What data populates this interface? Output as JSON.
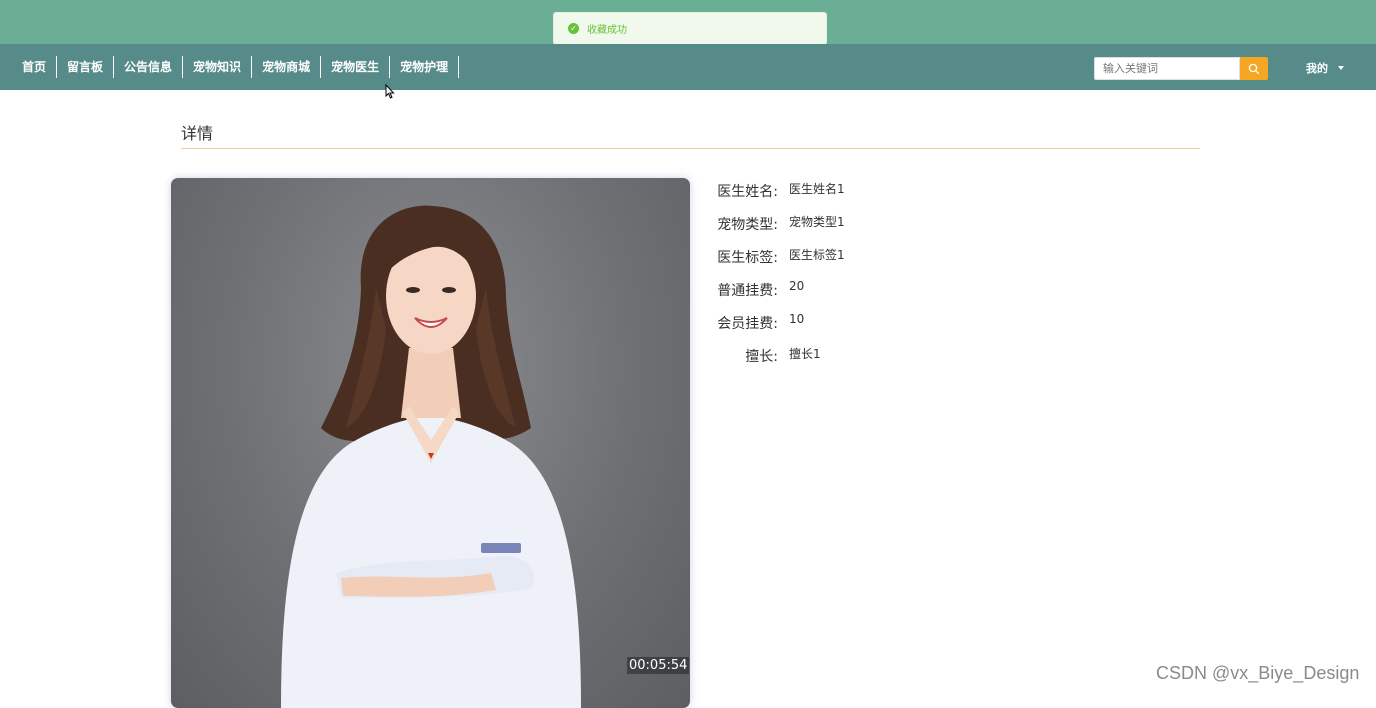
{
  "toast": {
    "icon": "check-circle-icon",
    "message": "收藏成功",
    "color": "#67c23a"
  },
  "nav": {
    "items": [
      "首页",
      "留言板",
      "公告信息",
      "宠物知识",
      "宠物商城",
      "宠物医生",
      "宠物护理"
    ],
    "search_placeholder": "输入关键词",
    "search_icon": "search-icon",
    "user_label": "我的",
    "user_icon": "caret-down-icon"
  },
  "colors": {
    "topbar": "#6aae96",
    "navbar": "#578b8a",
    "accent": "#f5a623"
  },
  "detail": {
    "title": "详情",
    "video_time": "00:05:54",
    "fields": [
      {
        "label": "医生姓名:",
        "value": "医生姓名1"
      },
      {
        "label": "宠物类型:",
        "value": "宠物类型1"
      },
      {
        "label": "医生标签:",
        "value": "医生标签1"
      },
      {
        "label": "普通挂费:",
        "value": "20"
      },
      {
        "label": "会员挂费:",
        "value": "10"
      },
      {
        "label": "擅长:",
        "value": "擅长1"
      }
    ]
  },
  "watermark": "CSDN @vx_Biye_Design"
}
